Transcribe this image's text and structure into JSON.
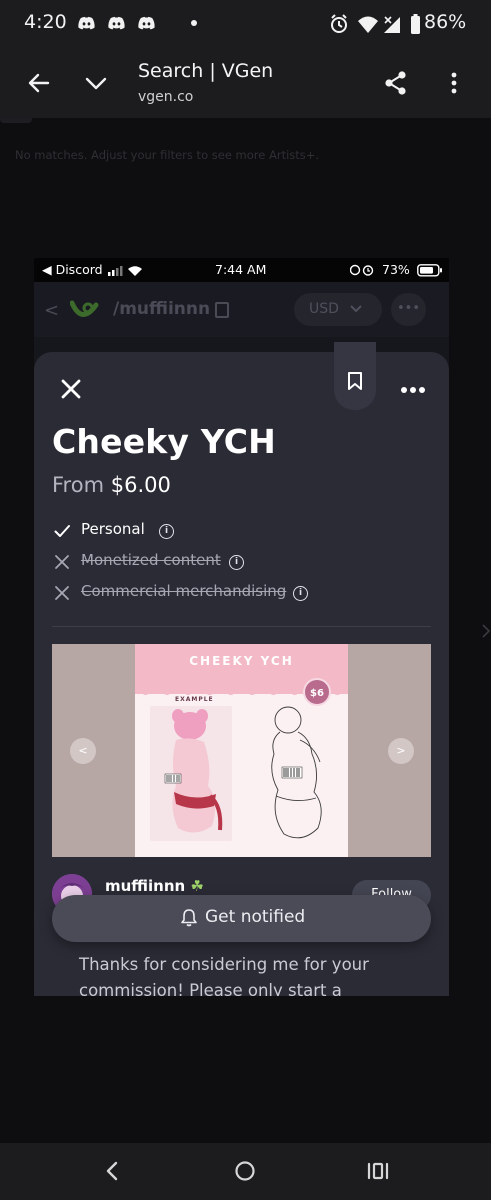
{
  "status_bar": {
    "time": "4:20",
    "battery": "86%",
    "icons": [
      "discord-icon",
      "discord-icon",
      "discord-icon",
      "dot-icon",
      "alarm-icon",
      "wifi-icon",
      "signal-icon",
      "battery-icon"
    ]
  },
  "toolbar": {
    "title": "Search | VGen",
    "url": "vgen.co",
    "icons": [
      "back-arrow-icon",
      "chevron-down-icon",
      "share-icon",
      "more-vert-icon"
    ]
  },
  "background_page": {
    "no_matches": "No matches. Adjust your filters to see more Artists+."
  },
  "inner_screenshot": {
    "status_bar": {
      "back_app": "◀ Discord",
      "time": "7:44 AM",
      "battery": "73%"
    },
    "header": {
      "username": "/muffiinnn",
      "currency": "USD"
    },
    "listing": {
      "title": "Cheeky YCH",
      "price_prefix": "From",
      "price": "$6.00",
      "licenses": [
        {
          "label": "Personal",
          "included": true
        },
        {
          "label": "Monetized content",
          "included": false
        },
        {
          "label": "Commercial merchandising",
          "included": false
        }
      ],
      "artwork": {
        "heading": "CHEEKY YCH",
        "price_badge": "$6",
        "example_label": "EXAMPLE"
      },
      "artist": {
        "name": "muffiinnn",
        "follow_label": "Follow"
      },
      "notify_label": "Get notified",
      "description": "Thanks for considering me for your commission! Please only start a request if"
    }
  },
  "colors": {
    "sheet_bg": "#2a2b35",
    "accent_pink": "#f3b9c6",
    "notify_bg": "#4a4b57"
  }
}
